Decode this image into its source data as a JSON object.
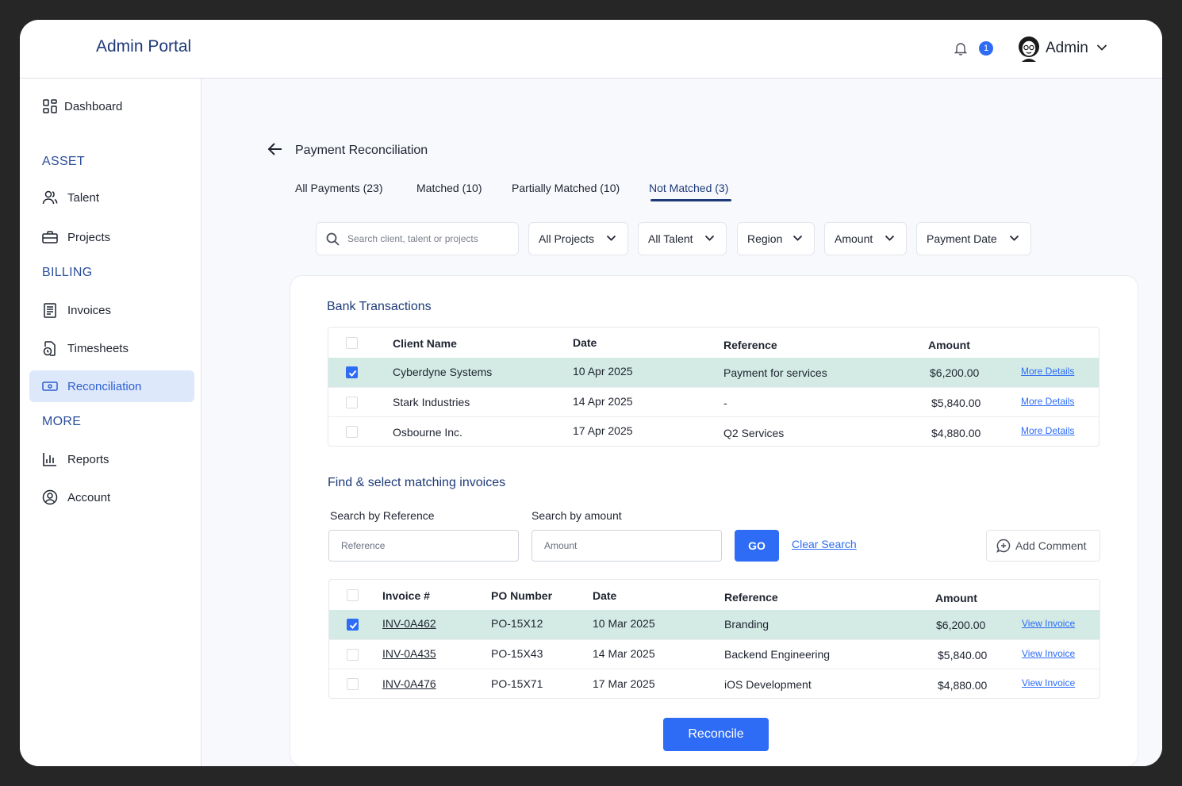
{
  "header": {
    "brand": "Admin Portal",
    "notification_count": "1",
    "user_name": "Admin"
  },
  "sidebar": {
    "dashboard": "Dashboard",
    "section_asset": "ASSET",
    "talent": "Talent",
    "projects": "Projects",
    "section_billing": "BILLING",
    "invoices": "Invoices",
    "timesheets": "Timesheets",
    "reconciliation": "Reconciliation",
    "section_more": "MORE",
    "reports": "Reports",
    "account": "Account"
  },
  "page": {
    "title": "Payment Reconciliation",
    "tabs": [
      {
        "label": "All Payments (23)"
      },
      {
        "label": "Matched (10)"
      },
      {
        "label": "Partially Matched (10)"
      },
      {
        "label": "Not Matched (3)"
      }
    ],
    "active_tab": 3,
    "search_placeholder": "Search client, talent or projects",
    "filters": [
      "All Projects",
      "All Talent",
      "Region",
      "Amount",
      "Payment Date"
    ]
  },
  "bank_transactions": {
    "heading": "Bank Transactions",
    "headers": {
      "client": "Client Name",
      "date": "Date",
      "reference": "Reference",
      "amount": "Amount"
    },
    "rows": [
      {
        "client": "Cyberdyne Systems",
        "date": "10 Apr 2025",
        "reference": "Payment for services",
        "amount": "$6,200.00",
        "link": "More Details",
        "checked": true
      },
      {
        "client": "Stark Industries",
        "date": "14 Apr 2025",
        "reference": "-",
        "amount": "$5,840.00",
        "link": "More Details",
        "checked": false
      },
      {
        "client": "Osbourne Inc.",
        "date": "17 Apr 2025",
        "reference": "Q2 Services",
        "amount": "$4,880.00",
        "link": "More Details",
        "checked": false
      }
    ]
  },
  "matching": {
    "heading": "Find & select matching invoices",
    "ref_label": "Search by Reference",
    "ref_placeholder": "Reference",
    "amount_label": "Search by amount",
    "amount_placeholder": "Amount",
    "go_label": "GO",
    "clear_label": "Clear Search",
    "comment_label": "Add Comment"
  },
  "invoices": {
    "headers": {
      "invoice": "Invoice #",
      "po": "PO Number",
      "date": "Date",
      "reference": "Reference",
      "amount": "Amount"
    },
    "rows": [
      {
        "invoice": "INV-0A462",
        "po": "PO-15X12",
        "date": "10 Mar 2025",
        "reference": "Branding",
        "amount": "$6,200.00",
        "link": "View Invoice",
        "checked": true
      },
      {
        "invoice": "INV-0A435",
        "po": "PO-15X43",
        "date": "14 Mar 2025",
        "reference": "Backend Engineering",
        "amount": "$5,840.00",
        "link": "View Invoice",
        "checked": false
      },
      {
        "invoice": "INV-0A476",
        "po": "PO-15X71",
        "date": "17 Mar 2025",
        "reference": "iOS Development",
        "amount": "$4,880.00",
        "link": "View Invoice",
        "checked": false
      }
    ]
  },
  "actions": {
    "reconcile_label": "Reconcile"
  },
  "colors": {
    "accent": "#2e6cf6",
    "navy": "#1e3a78",
    "selected_row": "#d3ebe4",
    "active_nav": "#dde8fb"
  }
}
